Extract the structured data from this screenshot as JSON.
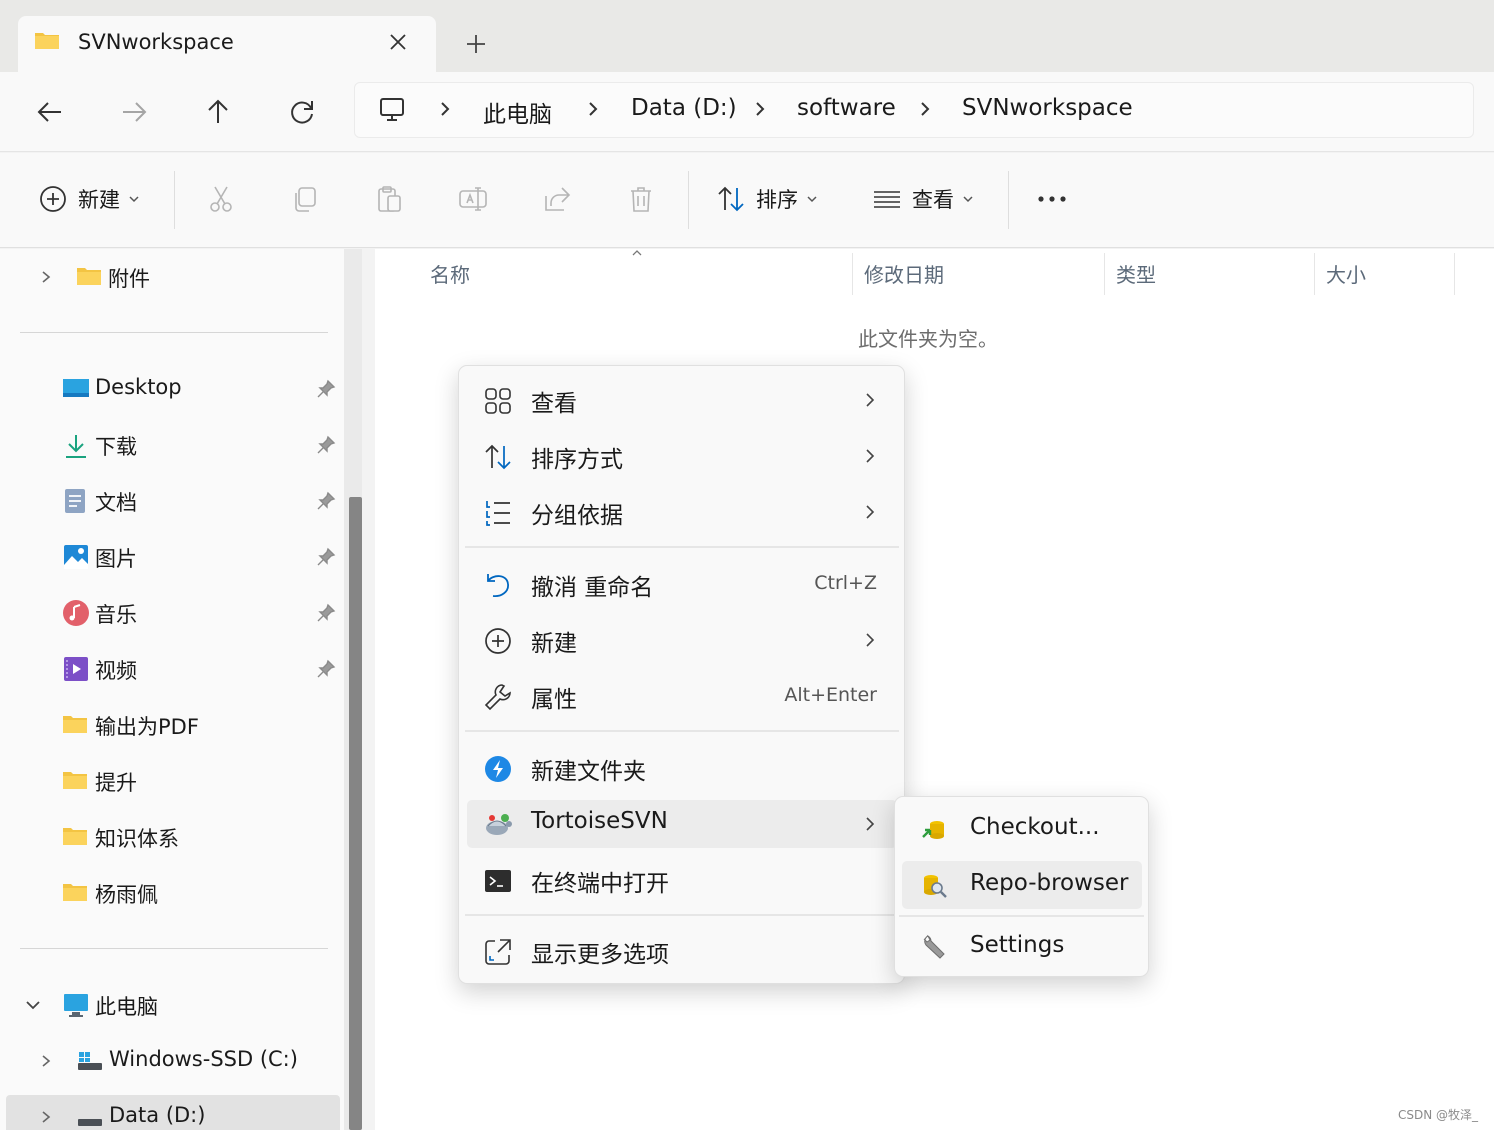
{
  "tab": {
    "title": "SVNworkspace"
  },
  "address": {
    "crumbs": [
      "此电脑",
      "Data (D:)",
      "software",
      "SVNworkspace"
    ]
  },
  "commandbar": {
    "new_label": "新建",
    "sort_label": "排序",
    "view_label": "查看"
  },
  "sidebar": {
    "top_item": "附件",
    "quick_access": [
      {
        "label": "Desktop",
        "icon": "desktop-icon",
        "pinned": true
      },
      {
        "label": "下载",
        "icon": "download-icon",
        "pinned": true
      },
      {
        "label": "文档",
        "icon": "document-icon",
        "pinned": true
      },
      {
        "label": "图片",
        "icon": "pictures-icon",
        "pinned": true
      },
      {
        "label": "音乐",
        "icon": "music-icon",
        "pinned": true
      },
      {
        "label": "视频",
        "icon": "video-icon",
        "pinned": true
      },
      {
        "label": "输出为PDF",
        "icon": "folder-icon",
        "pinned": false
      },
      {
        "label": "提升",
        "icon": "folder-icon",
        "pinned": false
      },
      {
        "label": "知识体系",
        "icon": "folder-icon",
        "pinned": false
      },
      {
        "label": "杨雨佩",
        "icon": "folder-icon",
        "pinned": false
      }
    ],
    "this_pc": "此电脑",
    "drives": [
      {
        "label": "Windows-SSD (C:)"
      },
      {
        "label": "Data (D:)"
      }
    ]
  },
  "main": {
    "columns": [
      "名称",
      "修改日期",
      "类型",
      "大小"
    ],
    "empty_text": "此文件夹为空。"
  },
  "context_menu": {
    "items": [
      {
        "label": "查看",
        "icon": "grid-icon",
        "submenu": true
      },
      {
        "label": "排序方式",
        "icon": "sort-icon",
        "submenu": true
      },
      {
        "label": "分组依据",
        "icon": "list-icon",
        "submenu": true
      },
      {
        "label": "撤消 重命名",
        "icon": "undo-icon",
        "shortcut": "Ctrl+Z"
      },
      {
        "label": "新建",
        "icon": "add-circle-icon",
        "submenu": true
      },
      {
        "label": "属性",
        "icon": "wrench-icon",
        "shortcut": "Alt+Enter"
      },
      {
        "label": "新建文件夹",
        "icon": "new-folder-icon"
      },
      {
        "label": "TortoiseSVN",
        "icon": "tortoise-icon",
        "submenu": true
      },
      {
        "label": "在终端中打开",
        "icon": "terminal-icon"
      },
      {
        "label": "显示更多选项",
        "icon": "more-options-icon"
      }
    ]
  },
  "svn_submenu": {
    "items": [
      {
        "label": "Checkout...",
        "icon": "checkout-icon"
      },
      {
        "label": "Repo-browser",
        "icon": "repo-browser-icon"
      },
      {
        "label": "Settings",
        "icon": "settings-wrench-icon"
      }
    ]
  },
  "watermark": "CSDN @牧泽_",
  "colors": {
    "folder": "#f3c443",
    "accent": "#0067c0",
    "menu_bg": "#f9f9f9"
  }
}
